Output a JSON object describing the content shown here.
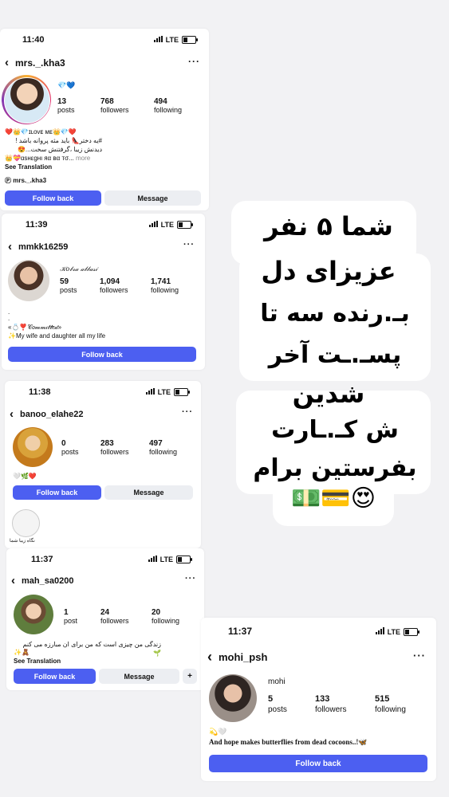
{
  "overlay": {
    "lines": [
      "شما ۵ نفر",
      "عزیزای دل",
      "بـ.رنده سه تا",
      "پسـ.ـت آخر",
      "شدین",
      "ش کـ.ـارت",
      "بفرستین برام"
    ],
    "emoji": "💵💳😍"
  },
  "profiles": [
    {
      "time": "11:40",
      "network": "LTE",
      "username": "mrs._.kha3",
      "name": "💎💙",
      "stats": [
        {
          "n": "13",
          "l": "posts"
        },
        {
          "n": "768",
          "l": "followers"
        },
        {
          "n": "494",
          "l": "following"
        }
      ],
      "bio": [
        "❤️👑💎ɪʟᴏᴠᴇ ᴍᴇ👑💎❤️",
        "#یه دختر👠 باید مثه پروانه باشد !",
        "دیدنش زیبا ،گرفتنش سخت...😍",
        "👑💝ɑsнεgнι яα вα тσ...",
        "more",
        "See Translation",
        "mrs._.kha3"
      ],
      "buttons": [
        "Follow back",
        "Message"
      ]
    },
    {
      "time": "11:39",
      "network": "LTE",
      "username": "mmkk16259",
      "name": "𝒦𝑜𝒷𝓇𝒶 𝒶𝒷𝒷𝒶𝓈𝒾",
      "stats": [
        {
          "n": "59",
          "l": "posts"
        },
        {
          "n": "1,094",
          "l": "followers"
        },
        {
          "n": "1,741",
          "l": "following"
        }
      ],
      "bio": [
        ".",
        ".",
        "«💍❣️𝒞𝑜𝓂𝓂𝒾𝓉𝓉𝑒𝒹»",
        "✨My wife and daughter all my life"
      ],
      "buttons": [
        "Follow back"
      ]
    },
    {
      "time": "11:38",
      "network": "LTE",
      "username": "banoo_elahe22",
      "stats": [
        {
          "n": "0",
          "l": "posts"
        },
        {
          "n": "283",
          "l": "followers"
        },
        {
          "n": "497",
          "l": "following"
        }
      ],
      "bio": [
        "🤍🌿❤️"
      ],
      "buttons": [
        "Follow back",
        "Message"
      ],
      "highlight": "نگاه زیبا شما"
    },
    {
      "time": "11:37",
      "network": "LTE",
      "username": "mah_sa0200",
      "stats": [
        {
          "n": "1",
          "l": "post"
        },
        {
          "n": "24",
          "l": "followers"
        },
        {
          "n": "20",
          "l": "following"
        }
      ],
      "bio": [
        "زندگی من چیزی است که من برای ان مبارزه می کنم 🌱",
        "✨🧸",
        "See Translation"
      ],
      "buttons": [
        "Follow back",
        "Message"
      ]
    },
    {
      "time": "11:37",
      "network": "LTE",
      "username": "mohi_psh",
      "name": "mohi",
      "stats": [
        {
          "n": "5",
          "l": "posts"
        },
        {
          "n": "133",
          "l": "followers"
        },
        {
          "n": "515",
          "l": "following"
        }
      ],
      "bio": [
        "💫🤍",
        "And hope makes butterflies from dead cocoons..!🦋"
      ],
      "buttons": [
        "Follow back"
      ]
    }
  ]
}
